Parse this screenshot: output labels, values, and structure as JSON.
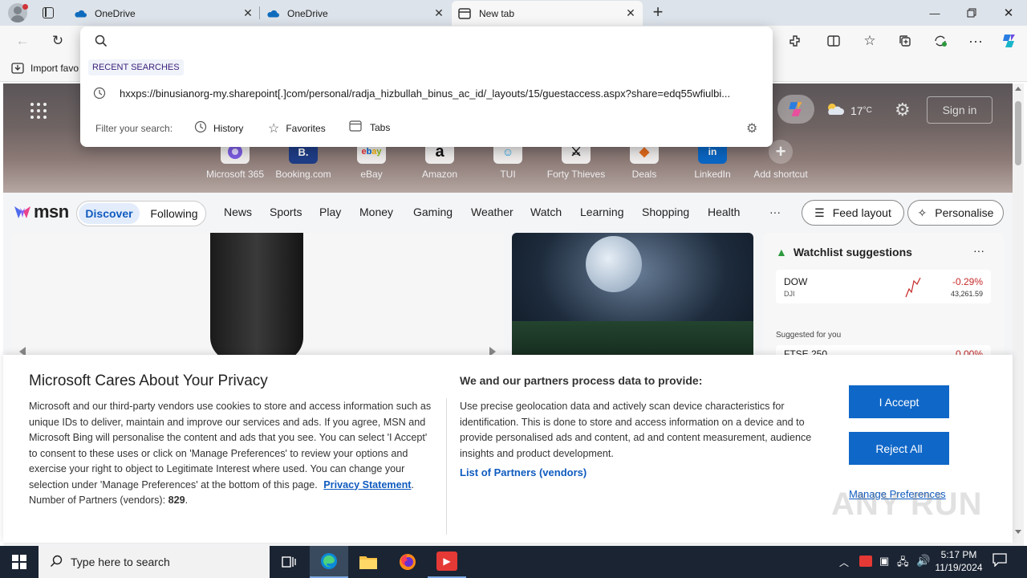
{
  "browser": {
    "tabs": [
      {
        "title": "OneDrive",
        "icon": "onedrive-icon"
      },
      {
        "title": "OneDrive",
        "icon": "onedrive-icon"
      },
      {
        "title": "New tab",
        "icon": "newtab-icon"
      }
    ],
    "favorites_bar": {
      "import_label": "Import favo"
    }
  },
  "omnibox": {
    "recent_heading": "RECENT SEARCHES",
    "recent_url": "hxxps://binusianorg-my.sharepoint[.]com/personal/radja_hizbullah_binus_ac_id/_layouts/15/guestaccess.aspx?share=edq55wfiulbi...",
    "filter_label": "Filter your search:",
    "filters": [
      "History",
      "Favorites",
      "Tabs"
    ]
  },
  "newtab": {
    "weather": "17",
    "weather_unit": "°C",
    "sign_in": "Sign in",
    "shortcuts": [
      "Microsoft 365",
      "Booking.com",
      "eBay",
      "Amazon",
      "TUI",
      "Forty Thieves",
      "Deals",
      "LinkedIn",
      "Add shortcut"
    ],
    "msn": {
      "logo": "msn",
      "tabs": [
        "Discover",
        "Following"
      ],
      "nav": [
        "News",
        "Sports",
        "Play",
        "Money",
        "Gaming",
        "Weather",
        "Watch",
        "Learning",
        "Shopping",
        "Health"
      ],
      "more": "···",
      "feed_layout": "Feed layout",
      "personalise": "Personalise"
    },
    "watchlist": {
      "title": "Watchlist suggestions",
      "more": "···",
      "stocks": [
        {
          "symbol": "DOW",
          "sub": "DJI",
          "change": "-0.29%",
          "price": "43,261.59"
        }
      ],
      "suggested_label": "Suggested for you",
      "suggested": [
        {
          "symbol": "FTSE 250",
          "change": "0.00%"
        }
      ]
    }
  },
  "privacy": {
    "title": "Microsoft Cares About Your Privacy",
    "body": "Microsoft and our third-party vendors use cookies to store and access information such as unique IDs to deliver, maintain and improve our services and ads. If you agree, MSN and Microsoft Bing will personalise the content and ads that you see. You can select 'I Accept' to consent to these uses or click on 'Manage Preferences' to review your options and exercise your right to object to Legitimate Interest where used.  You can change your selection under 'Manage Preferences' at the bottom of this page.",
    "statement_link": "Privacy Statement",
    "partners_label": "Number of Partners (vendors):",
    "partners_count": "829",
    "right_title": "We and our partners process data to provide:",
    "right_body": "Use precise geolocation data and actively scan device characteristics for identification. This is done to store and access information on a device and to provide personalised ads and content, ad and content measurement, audience insights and product development.",
    "partners_link": "List of Partners (vendors)",
    "accept": "I Accept",
    "reject": "Reject All",
    "manage": "Manage Preferences"
  },
  "taskbar": {
    "search_placeholder": "Type here to search",
    "time": "5:17 PM",
    "date": "11/19/2024"
  },
  "watermark": "ANY RUN"
}
